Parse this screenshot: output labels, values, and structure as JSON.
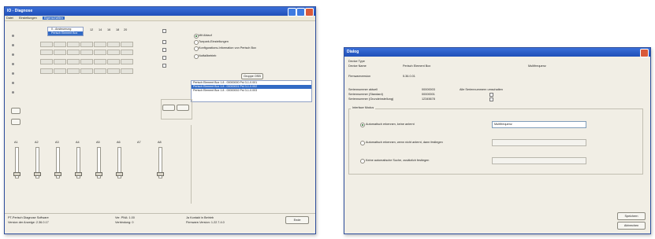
{
  "left": {
    "title": "IO - Diagnose",
    "menu": [
      "Datei",
      "Einstellungen",
      "Eigenschaften"
    ],
    "selected_menu": "Eigenschaften",
    "dropdown": [
      "0 - Ansteuerung",
      "Perisch Element Box"
    ],
    "top_numbers": [
      "12",
      "14",
      "16",
      "18",
      "20"
    ],
    "options": [
      "Mit Ablauf",
      "Tuepark-Einstellungen",
      "Konfigurations-Information von Perisch Box",
      "Notfallbetrieb"
    ],
    "list_header": "Gruppe OSB",
    "list_rows": [
      "Perisch Element Box   1.8 - 00000000   Pst 3-1-0.001",
      "Perisch Element Box   1.8 - 00000001   Pst 3-1-0.002",
      "Perisch Element Box   1.8 - 00000002   Pst 3-1-0.003"
    ],
    "channels": [
      "A1",
      "A2",
      "A3",
      "A4",
      "A5",
      "A6",
      "A7",
      "A8"
    ],
    "status_left": [
      "PT-Perisch Diagnose Software",
      "Version der Anzeige: 2.36.0.17"
    ],
    "status_mid": [
      "Ver. PNA:  1.00",
      "Verbindung: 0"
    ],
    "status_right": [
      "Ja Kontakt in Betrieb",
      "Firmware-Version: 1.22.7.4.0"
    ],
    "close_button": "Ende"
  },
  "dialog": {
    "title": "Dialog",
    "device_type_label": "Device Type",
    "device_name_label": "Device Name",
    "device_name_value": "Perisch Element Box",
    "extra_value": "Multifrequenz",
    "firmware_label": "Firmwareversion",
    "firmware_value": "5.36.0.01",
    "serial_rows": [
      {
        "label": "Seriennummer aktuell",
        "value": "00000003"
      },
      {
        "label": "Seriennummer (Standard)",
        "value": "00000001"
      },
      {
        "label": "Seriennummer (Grundeinstellung)",
        "value": "12345678"
      }
    ],
    "check_label": "Alle Seriennummern umschalten",
    "group_title": "Interface Modus",
    "radio_options": [
      "Automatisch erkennen, keine anlernt",
      "Automatisch erkennen, wenn nicht anlernt, dann festlegen",
      "Keine automatische Suche, zusätzlich festlegen"
    ],
    "radio_selected": 0,
    "text_value": "Multifrequenz",
    "save_button": "Speichern",
    "cancel_button": "Abbrechen"
  }
}
